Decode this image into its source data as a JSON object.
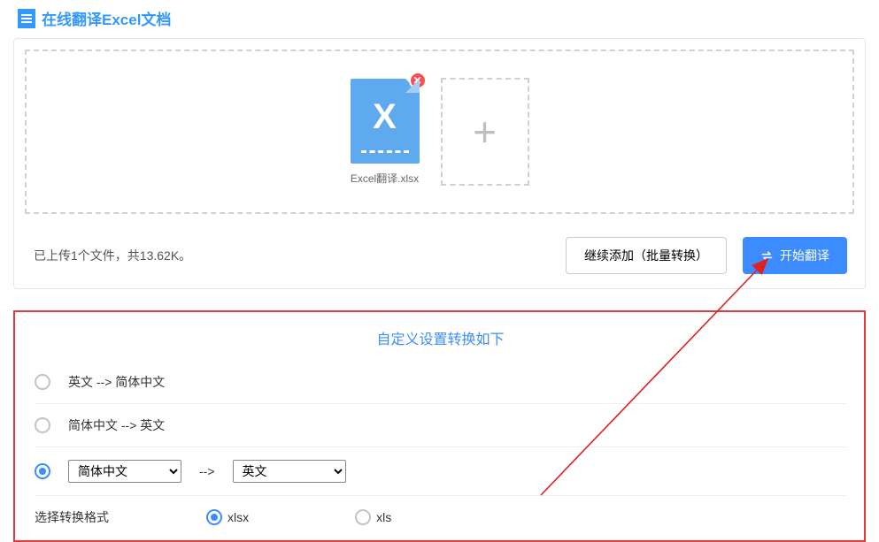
{
  "page": {
    "title": "在线翻译Excel文档"
  },
  "upload": {
    "file": {
      "name": "Excel翻译.xlsx",
      "letter": "X"
    },
    "remove_glyph": "✕",
    "add_glyph": "+",
    "status": "已上传1个文件，共13.62K。",
    "actions": {
      "add_more": "继续添加（批量转换）",
      "start": "开始翻译"
    }
  },
  "settings": {
    "title": "自定义设置转换如下",
    "options": [
      {
        "label": "英文 --> 简体中文",
        "selected": false
      },
      {
        "label": "简体中文 --> 英文",
        "selected": false
      }
    ],
    "custom": {
      "selected": true,
      "source": "简体中文",
      "target": "英文",
      "arrow": "-->"
    },
    "format": {
      "label": "选择转换格式",
      "options": [
        {
          "label": "xlsx",
          "selected": true
        },
        {
          "label": "xls",
          "selected": false
        }
      ]
    }
  },
  "colors": {
    "accent": "#3c8cff",
    "danger_border": "#e33b37",
    "arrow": "#d22"
  }
}
